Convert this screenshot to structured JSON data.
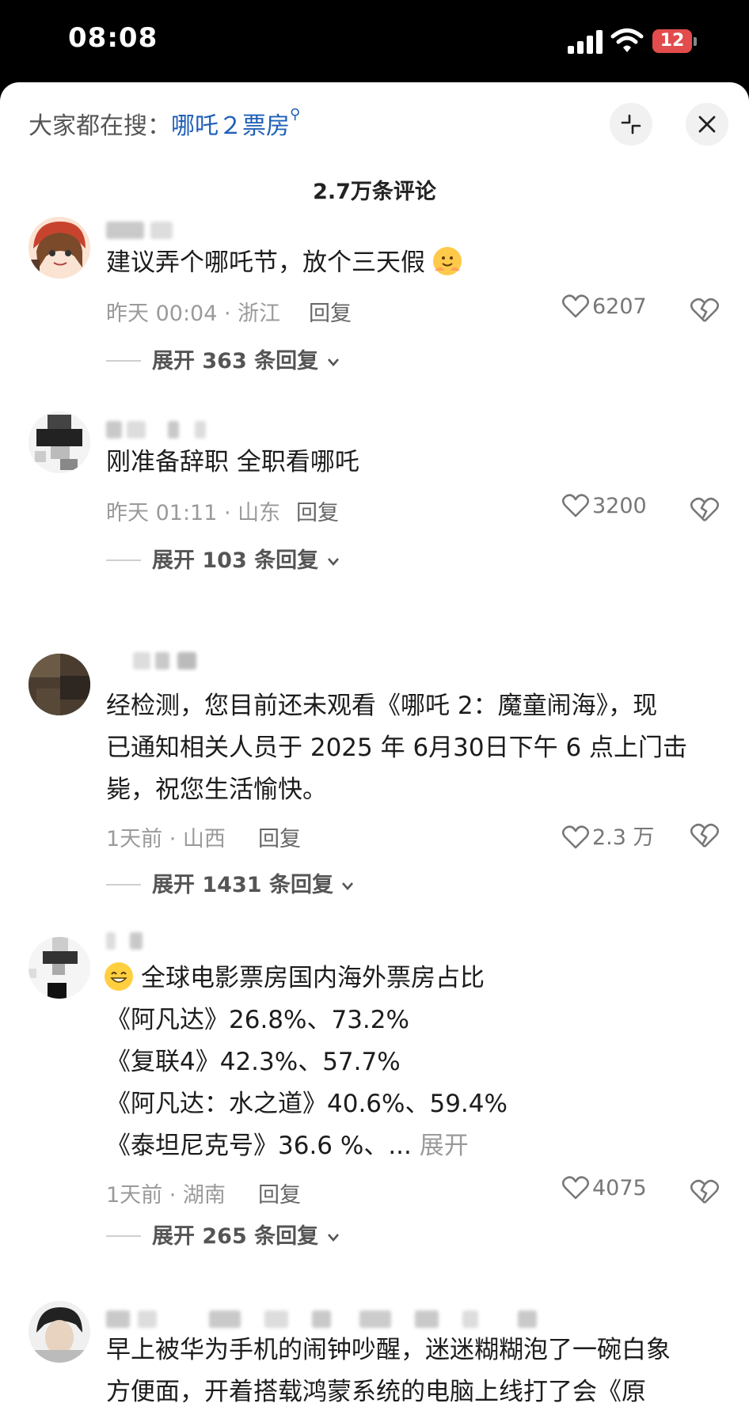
{
  "status_bar": {
    "time": "08:08",
    "battery": "12"
  },
  "header": {
    "search_prefix": "大家都在搜：",
    "search_term": "哪吒２票房",
    "comment_count": "2.7万条评论"
  },
  "comments": [
    {
      "lines": [
        "建议弄个哪吒节，放个三天假"
      ],
      "time_location": "昨天 00:04 · 浙江",
      "reply": "回复",
      "likes": "6207",
      "expand": "展开 363 条回复"
    },
    {
      "lines": [
        "刚准备辞职 全职看哪吒"
      ],
      "time_location": "昨天 01:11 · 山东",
      "reply": "回复",
      "likes": "3200",
      "expand": "展开 103 条回复"
    },
    {
      "lines": [
        "经检测，您目前还未观看《哪吒 2：魔童闹海》，现",
        "已通知相关人员于 2025 年 6月30日下午 6 点上门击",
        "毙，祝您生活愉快。"
      ],
      "time_location": "1天前 · 山西",
      "reply": "回复",
      "likes": "2.3 万",
      "expand": "展开 1431 条回复"
    },
    {
      "lines": [
        "全球电影票房国内海外票房占比",
        "《阿凡达》26.8%、73.2%",
        "《复联4》42.3%、57.7%",
        "《阿凡达：水之道》40.6%、59.4%",
        "《泰坦尼克号》36.6 %、..."
      ],
      "more": "展开",
      "time_location": "1天前 · 湖南",
      "reply": "回复",
      "likes": "4075",
      "expand": "展开 265 条回复"
    },
    {
      "lines": [
        "早上被华为手机的闹钟吵醒，迷迷糊糊泡了一碗白象",
        "方便面，开着搭载鸿蒙系统的电脑上线打了会《原"
      ]
    }
  ],
  "colors": {
    "accent_link": "#1e5fb8",
    "battery": "#e24c4c",
    "sheet_bg": "#ffffff",
    "meta": "#9a9a9a"
  },
  "icons": [
    "signal-icon",
    "wifi-icon",
    "collapse-icon",
    "close-icon",
    "heart-icon",
    "broken-heart-icon",
    "chevron-down-icon"
  ]
}
